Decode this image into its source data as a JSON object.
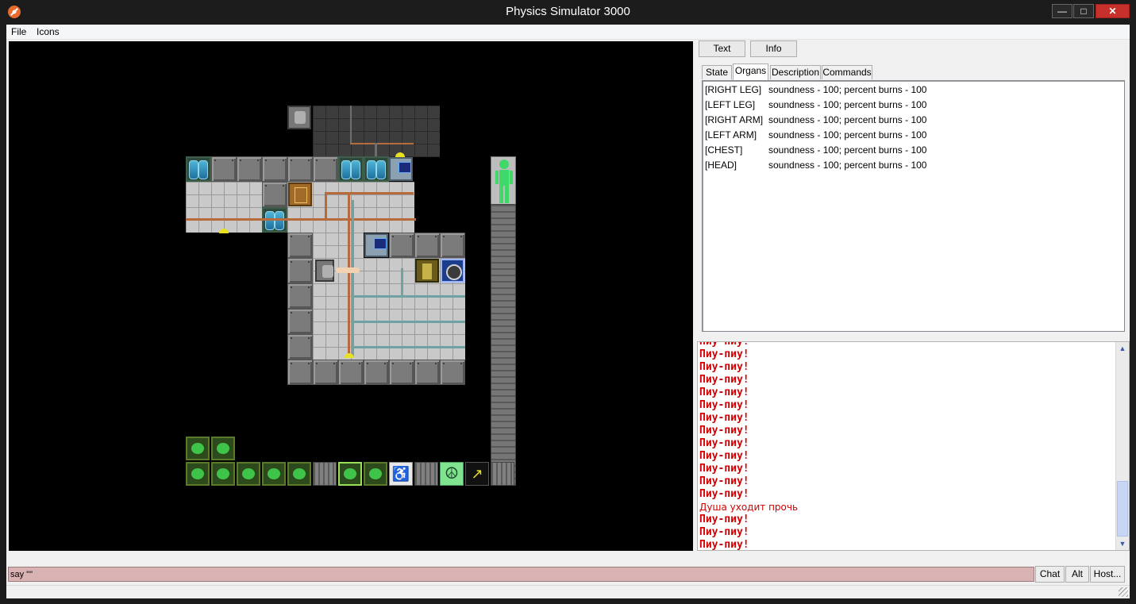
{
  "window": {
    "title": "Physics Simulator 3000",
    "minimize_glyph": "—",
    "maximize_glyph": "□",
    "close_glyph": "✕"
  },
  "menu": {
    "file": "File",
    "icons": "Icons"
  },
  "panel": {
    "text_button": "Text",
    "info_button": "Info",
    "tabs": [
      "State",
      "Organs",
      "Description",
      "Commands"
    ],
    "active_tab": "Organs",
    "organs": [
      {
        "name": "[RIGHT LEG]",
        "value": "soundness - 100; percent burns - 100"
      },
      {
        "name": "[LEFT LEG]",
        "value": "soundness - 100; percent burns - 100"
      },
      {
        "name": "[RIGHT ARM]",
        "value": "soundness - 100; percent burns - 100"
      },
      {
        "name": "[LEFT ARM]",
        "value": "soundness - 100; percent burns - 100"
      },
      {
        "name": "[CHEST]",
        "value": "soundness - 100; percent burns - 100"
      },
      {
        "name": "[HEAD]",
        "value": "soundness - 100; percent burns - 100"
      }
    ]
  },
  "chat": {
    "lines": [
      {
        "text": "Пиу-пиу!",
        "style": "bold"
      },
      {
        "text": "Пиу-пиу!",
        "style": "bold"
      },
      {
        "text": "Пиу-пиу!",
        "style": "bold"
      },
      {
        "text": "Пиу-пиу!",
        "style": "bold"
      },
      {
        "text": "Пиу-пиу!",
        "style": "bold"
      },
      {
        "text": "Пиу-пиу!",
        "style": "bold"
      },
      {
        "text": "Пиу-пиу!",
        "style": "bold"
      },
      {
        "text": "Пиу-пиу!",
        "style": "bold"
      },
      {
        "text": "Пиу-пиу!",
        "style": "bold"
      },
      {
        "text": "Пиу-пиу!",
        "style": "bold"
      },
      {
        "text": "Пиу-пиу!",
        "style": "bold"
      },
      {
        "text": "Пиу-пиу!",
        "style": "bold"
      },
      {
        "text": "Пиу-пиу!",
        "style": "bold"
      },
      {
        "text": "Душа уходит прочь",
        "style": "plain"
      },
      {
        "text": "Пиу-пиу!",
        "style": "bold"
      },
      {
        "text": "Пиу-пиу!",
        "style": "bold"
      },
      {
        "text": "Пиу-пиу!",
        "style": "bold"
      }
    ],
    "scroll_up_glyph": "▲",
    "scroll_down_glyph": "▼"
  },
  "input": {
    "value": "say \"\""
  },
  "bottom_buttons": {
    "chat": "Chat",
    "alt": "Alt",
    "host": "Host..."
  },
  "hud": {
    "intent_glyph": "☮",
    "pull_glyph": "♿",
    "run_glyph": "↗"
  },
  "colors": {
    "chat_text": "#d10000",
    "input_background": "#d9b3b3",
    "map_background": "#000000",
    "close_button": "#c7302b"
  }
}
